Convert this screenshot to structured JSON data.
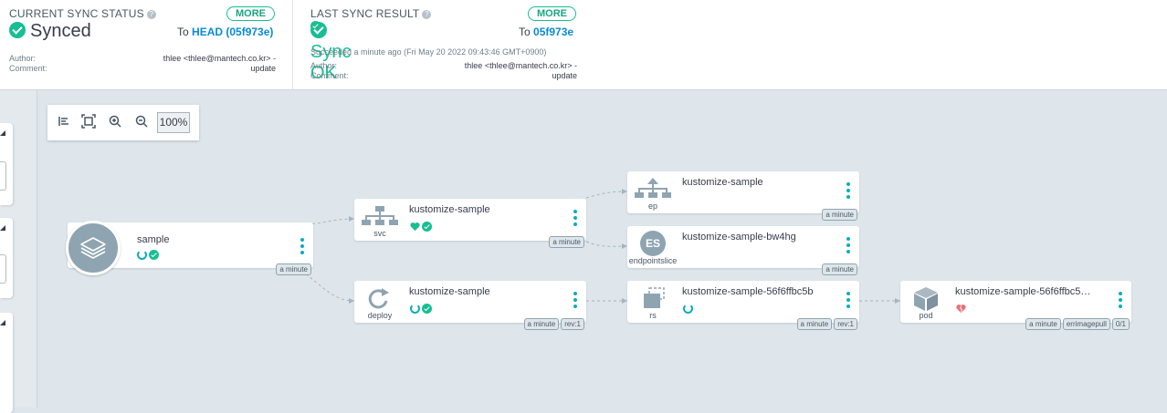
{
  "current_sync": {
    "title": "CURRENT SYNC STATUS",
    "help_icon": "question-icon",
    "more_label": "MORE",
    "status": "Synced",
    "to_label": "To",
    "target": "HEAD (05f973e)",
    "author_label": "Author:",
    "author_value": "thlee <thlee@mantech.co.kr> -",
    "comment_label": "Comment:",
    "comment_value": "update"
  },
  "last_sync": {
    "title": "LAST SYNC RESULT",
    "help_icon": "question-icon",
    "more_label": "MORE",
    "status": "Sync OK",
    "to_label": "To",
    "target": "05f973e",
    "succeeded": "Succeeded a minute ago (Fri May 20 2022 09:43:46 GMT+0900)",
    "author_label": "Author:",
    "author_value": "thlee <thlee@mantech.co.kr> -",
    "comment_label": "Comment:",
    "comment_value": "update"
  },
  "toolbar": {
    "icons": [
      "align-left-icon",
      "fit-screen-icon",
      "zoom-in-icon",
      "zoom-out-icon"
    ],
    "zoom": "100%"
  },
  "colors": {
    "synced": "#18be94",
    "progressing": "#0dadbb",
    "degraded": "#e96d76",
    "link": "#0a8ad6"
  },
  "app": {
    "name": "sample",
    "age": "a minute",
    "icon": "layers-icon"
  },
  "nodes": {
    "svc": {
      "name": "kustomize-sample",
      "kind": "svc",
      "age": "a minute"
    },
    "deploy": {
      "name": "kustomize-sample",
      "kind": "deploy",
      "age": "a minute",
      "rev": "rev:1"
    },
    "ep": {
      "name": "kustomize-sample",
      "kind": "ep",
      "age": "a minute"
    },
    "es": {
      "name": "kustomize-sample-bw4hg",
      "kind": "endpointslice",
      "badge": "ES",
      "age": "a minute"
    },
    "rs": {
      "name": "kustomize-sample-56f6ffbc5b",
      "kind": "rs",
      "age": "a minute",
      "rev": "rev:1"
    },
    "pod": {
      "name": "kustomize-sample-56f6ffbc5…",
      "kind": "pod",
      "age": "a minute",
      "status": "errimagepull",
      "ready": "0/1"
    }
  }
}
